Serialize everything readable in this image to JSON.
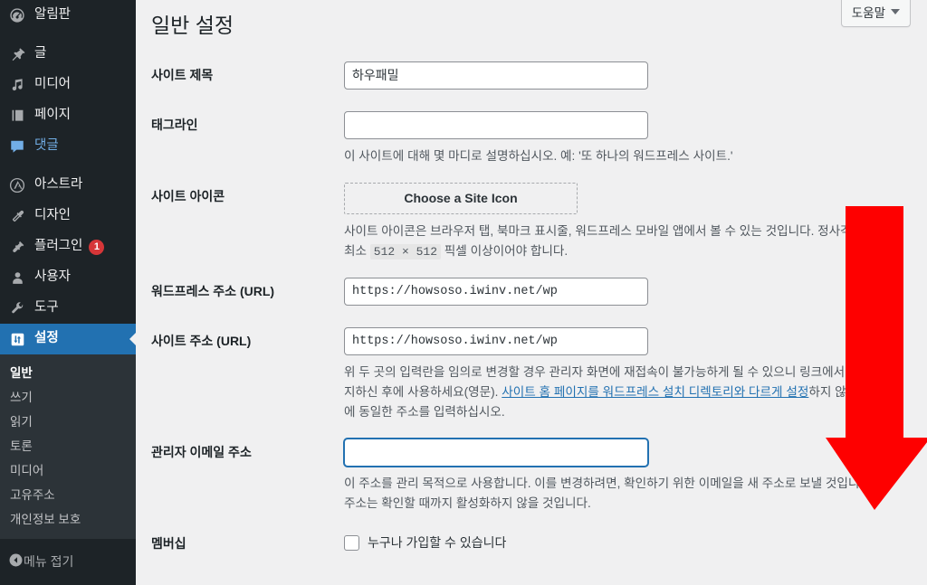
{
  "sidebar": {
    "items": [
      {
        "label": "알림판",
        "icon": "dashboard-icon",
        "state": "normal"
      },
      {
        "label": "글",
        "icon": "pin-icon",
        "state": "normal"
      },
      {
        "label": "미디어",
        "icon": "media-icon",
        "state": "normal"
      },
      {
        "label": "페이지",
        "icon": "pages-icon",
        "state": "normal"
      },
      {
        "label": "댓글",
        "icon": "comments-icon",
        "state": "highlight"
      },
      {
        "label": "아스트라",
        "icon": "astra-icon",
        "state": "normal"
      },
      {
        "label": "디자인",
        "icon": "appearance-icon",
        "state": "normal"
      },
      {
        "label": "플러그인",
        "icon": "plugins-icon",
        "state": "normal",
        "badge": "1"
      },
      {
        "label": "사용자",
        "icon": "users-icon",
        "state": "normal"
      },
      {
        "label": "도구",
        "icon": "tools-icon",
        "state": "normal"
      },
      {
        "label": "설정",
        "icon": "settings-icon",
        "state": "active"
      }
    ],
    "submenu": [
      {
        "label": "일반",
        "current": true
      },
      {
        "label": "쓰기",
        "current": false
      },
      {
        "label": "읽기",
        "current": false
      },
      {
        "label": "토론",
        "current": false
      },
      {
        "label": "미디어",
        "current": false
      },
      {
        "label": "고유주소",
        "current": false
      },
      {
        "label": "개인정보 보호",
        "current": false
      }
    ],
    "collapse_label": "메뉴 접기",
    "bg_color": "#1d2327",
    "submenu_bg_color": "#2c3338",
    "active_color": "#2271b1"
  },
  "header": {
    "help_label": "도움말"
  },
  "page": {
    "title": "일반 설정"
  },
  "fields": {
    "site_title": {
      "label": "사이트 제목",
      "value": "하우패밀"
    },
    "tagline": {
      "label": "태그라인",
      "value": "",
      "description": "이 사이트에 대해 몇 마디로 설명하십시오. 예: '또 하나의 워드프레스 사이트.'"
    },
    "site_icon": {
      "label": "사이트 아이콘",
      "button_label": "Choose a Site Icon",
      "description_part1": "사이트 아이콘은 브라우저 탭, 북마크 표시줄, 워드프레스 모바일 앱에서 볼 수 있는 것입니다. 정사각형이며 최소 ",
      "description_size": "512 × 512",
      "description_part2": " 픽셀 이상이어야 합니다."
    },
    "wordpress_url": {
      "label": "워드프레스 주소 (URL)",
      "value": "https://howsoso.iwinv.net/wp"
    },
    "site_url": {
      "label": "사이트 주소 (URL)",
      "value": "https://howsoso.iwinv.net/wp",
      "description_part1": "위 두 곳의 입력란을 임의로 변경할 경우 관리자 화면에 재접속이 불가능하게 될 수 있으니 링크에서 내용을 숙지하신 후에 사용하세요(영문). ",
      "description_link": "사이트 홈 페이지를 워드프레스 설치 디렉토리와 다르게 설정",
      "description_part2": "하지 않는 한 여기에 동일한 주소를 입력하십시오."
    },
    "admin_email": {
      "label": "관리자 이메일 주소",
      "value": "",
      "focused": true,
      "description": "이 주소를 관리 목적으로 사용합니다. 이를 변경하려면, 확인하기 위한 이메일을 새 주소로 보낼 것입니다. 새 주소는 확인할 때까지 활성화하지 않을 것입니다."
    },
    "membership": {
      "label": "멤버십",
      "checkbox_label": "누구나 가입할 수 있습니다",
      "checked": false
    }
  },
  "annotation": {
    "arrow_color": "#FE0000",
    "arrow_direction": "down"
  }
}
